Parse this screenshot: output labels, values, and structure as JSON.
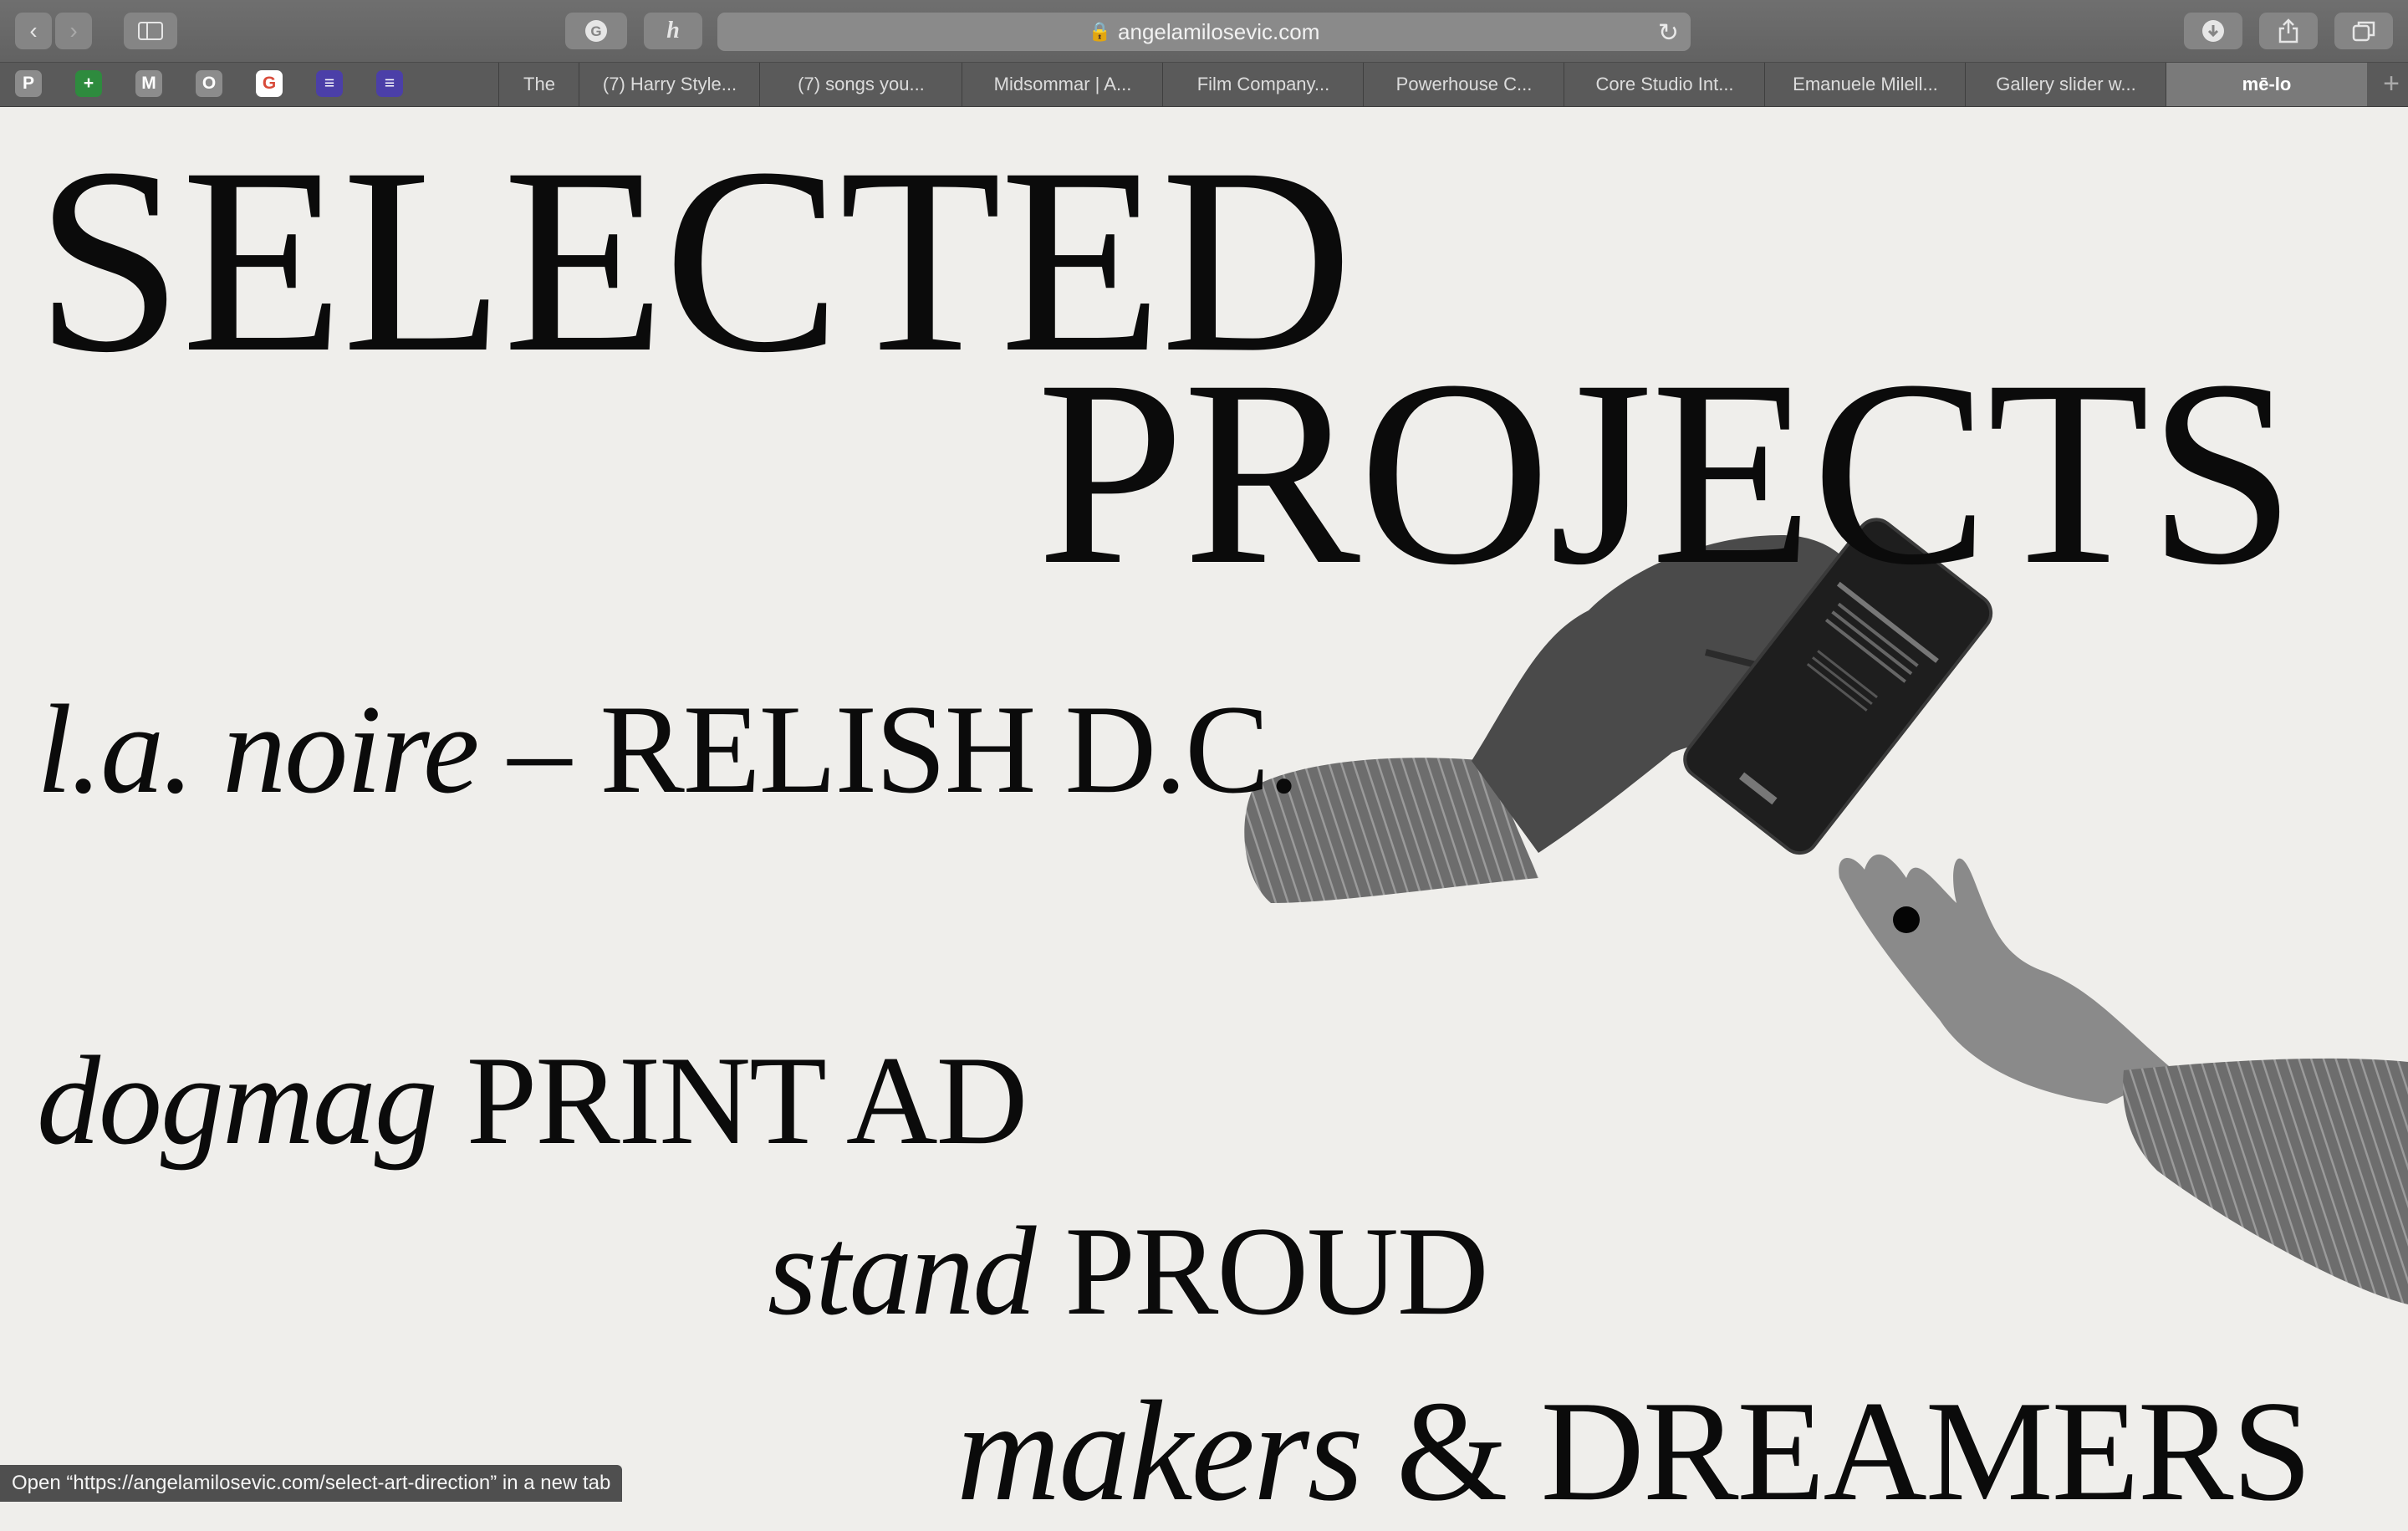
{
  "browser": {
    "url": "angelamilosevic.com",
    "tabs": [
      {
        "label": "The",
        "active": false
      },
      {
        "label": "(7) Harry Style...",
        "active": false
      },
      {
        "label": "(7) songs you...",
        "active": false
      },
      {
        "label": "Midsommar | A...",
        "active": false
      },
      {
        "label": "Film Company...",
        "active": false
      },
      {
        "label": "Powerhouse C...",
        "active": false
      },
      {
        "label": "Core Studio Int...",
        "active": false
      },
      {
        "label": "Emanuele Milell...",
        "active": false
      },
      {
        "label": "Gallery slider w...",
        "active": false
      },
      {
        "label": "mē-lo",
        "active": true
      }
    ],
    "favorites": [
      {
        "letter": "P",
        "color": "#8c8c8c"
      },
      {
        "letter": "+",
        "color": "#2e8b3e"
      },
      {
        "letter": "M",
        "color": "#8c8c8c"
      },
      {
        "letter": "O",
        "color": "#8c8c8c"
      },
      {
        "letter": "G",
        "color": "#ffffff"
      },
      {
        "letter": "≡",
        "color": "#4b3fa8"
      },
      {
        "letter": "≡",
        "color": "#4b3fa8"
      }
    ],
    "status_text": "Open “https://angelamilosevic.com/select-art-direction” in a new tab"
  },
  "page": {
    "heading_line1": "SELECTED",
    "heading_line2": "PROJECTS",
    "projects": [
      {
        "italic": "l.a. noire",
        "sep": " – ",
        "caps": "RELISH D.C."
      },
      {
        "italic": "dogmag",
        "sep": " ",
        "caps": "PRINT AD"
      },
      {
        "italic": "stand",
        "sep": " ",
        "caps": "PROUD"
      },
      {
        "italic": "makers",
        "sep": " ",
        "caps": "& DREAMERS"
      }
    ]
  },
  "colors": {
    "background": "#efeeeb",
    "text": "#0b0b0b",
    "chrome": "#666666"
  }
}
